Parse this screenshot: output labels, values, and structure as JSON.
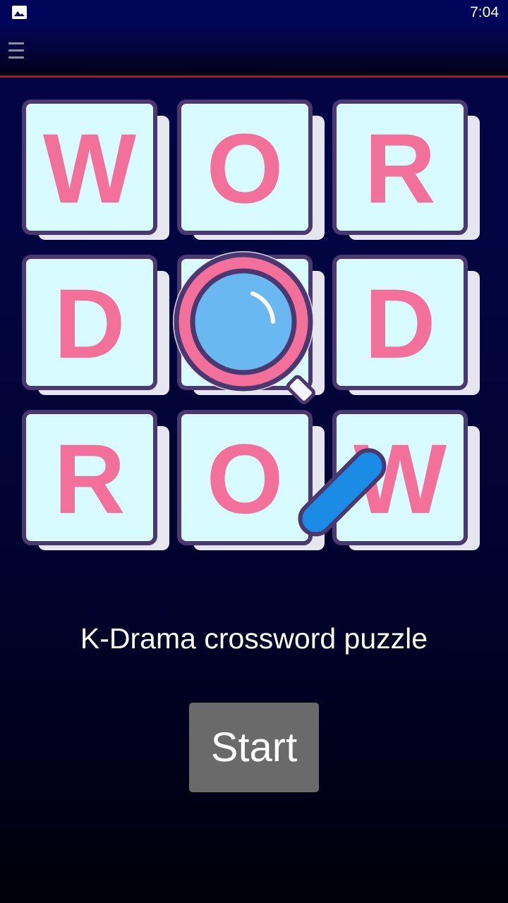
{
  "status_bar": {
    "time": "7:04",
    "notification_icon": "image-icon"
  },
  "app_bar": {
    "menu_icon": "hamburger-menu-icon",
    "accent_line_color": "#c01010"
  },
  "logo": {
    "tiles": [
      "W",
      "O",
      "R",
      "D",
      "",
      "D",
      "R",
      "O",
      "W"
    ],
    "center_icon": "magnifying-glass-icon",
    "tile_color": "#d8fbff",
    "letter_color": "#f2709a",
    "outline_color": "#4b3870"
  },
  "main": {
    "tagline": "K-Drama crossword puzzle",
    "start_label": "Start",
    "start_button_color": "#6a6a6a"
  }
}
